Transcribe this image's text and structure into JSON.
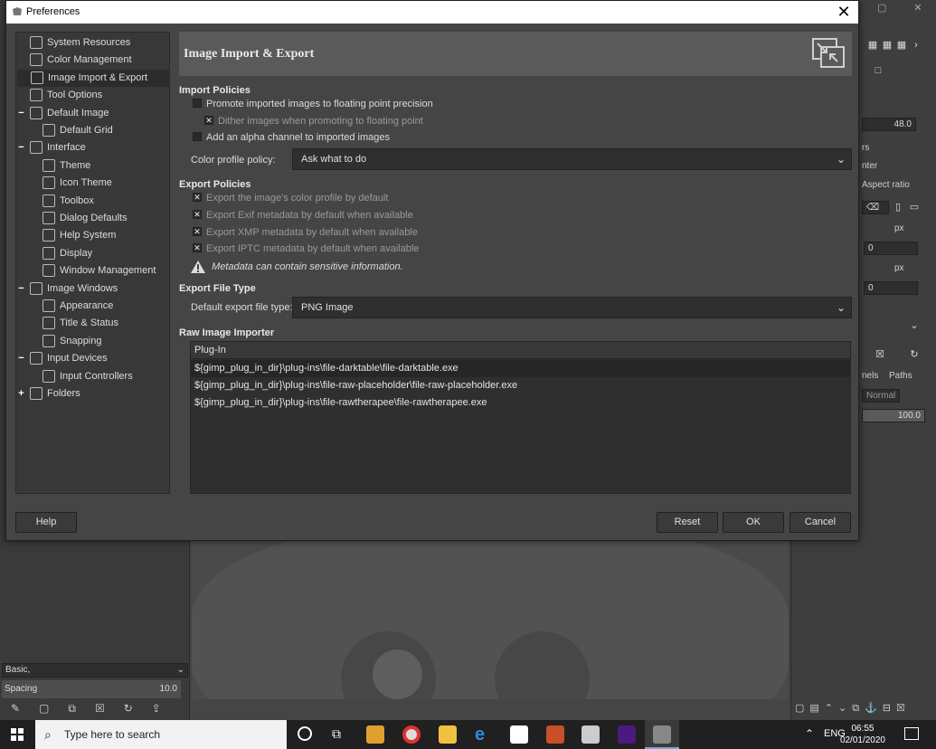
{
  "window": {
    "title": "Preferences"
  },
  "tree": [
    {
      "label": "System Resources",
      "level": 1,
      "expander": ""
    },
    {
      "label": "Color Management",
      "level": 1,
      "expander": ""
    },
    {
      "label": "Image Import & Export",
      "level": 1,
      "expander": "",
      "selected": true
    },
    {
      "label": "Tool Options",
      "level": 1,
      "expander": ""
    },
    {
      "label": "Default Image",
      "level": 1,
      "expander": "−"
    },
    {
      "label": "Default Grid",
      "level": 2,
      "expander": ""
    },
    {
      "label": "Interface",
      "level": 1,
      "expander": "−"
    },
    {
      "label": "Theme",
      "level": 2,
      "expander": ""
    },
    {
      "label": "Icon Theme",
      "level": 2,
      "expander": ""
    },
    {
      "label": "Toolbox",
      "level": 2,
      "expander": ""
    },
    {
      "label": "Dialog Defaults",
      "level": 2,
      "expander": ""
    },
    {
      "label": "Help System",
      "level": 2,
      "expander": ""
    },
    {
      "label": "Display",
      "level": 2,
      "expander": ""
    },
    {
      "label": "Window Management",
      "level": 2,
      "expander": ""
    },
    {
      "label": "Image Windows",
      "level": 1,
      "expander": "−"
    },
    {
      "label": "Appearance",
      "level": 2,
      "expander": ""
    },
    {
      "label": "Title & Status",
      "level": 2,
      "expander": ""
    },
    {
      "label": "Snapping",
      "level": 2,
      "expander": ""
    },
    {
      "label": "Input Devices",
      "level": 1,
      "expander": "−"
    },
    {
      "label": "Input Controllers",
      "level": 2,
      "expander": ""
    },
    {
      "label": "Folders",
      "level": 1,
      "expander": "+"
    }
  ],
  "header": {
    "title": "Image Import & Export"
  },
  "import": {
    "heading": "Import Policies",
    "promote": "Promote imported images to floating point precision",
    "dither": "Dither images when promoting to floating point",
    "alpha": "Add an alpha channel to imported images",
    "profile_label": "Color profile policy:",
    "profile_value": "Ask what to do"
  },
  "export": {
    "heading": "Export Policies",
    "color_profile": "Export the image's color profile by default",
    "exif": "Export Exif metadata by default when available",
    "xmp": "Export XMP metadata by default when available",
    "iptc": "Export IPTC metadata by default when available",
    "warning": "Metadata can contain sensitive information."
  },
  "filetype": {
    "heading": "Export File Type",
    "label": "Default export file type:",
    "value": "PNG Image"
  },
  "raw": {
    "heading": "Raw Image Importer",
    "column": "Plug-In",
    "rows": [
      "${gimp_plug_in_dir}\\plug-ins\\file-darktable\\file-darktable.exe",
      "${gimp_plug_in_dir}\\plug-ins\\file-raw-placeholder\\file-raw-placeholder.exe",
      "${gimp_plug_in_dir}\\plug-ins\\file-rawtherapee\\file-rawtherapee.exe"
    ]
  },
  "buttons": {
    "help": "Help",
    "reset": "Reset",
    "ok": "OK",
    "cancel": "Cancel"
  },
  "gimp": {
    "brush_preset": "Basic,",
    "spacing_label": "Spacing",
    "spacing_value": "10.0",
    "value_48": "48.0",
    "aspect": "Aspect ratio",
    "unit_px": "px",
    "zero": "0",
    "mode": "Normal",
    "opacity": "100.0",
    "frag_rs": "rs",
    "frag_enter": "nter",
    "tab_nels": "nels",
    "tab_paths": "Paths"
  },
  "taskbar": {
    "search_placeholder": "Type here to search",
    "lang": "ENG",
    "time": "06:55",
    "date": "02/01/2020"
  }
}
